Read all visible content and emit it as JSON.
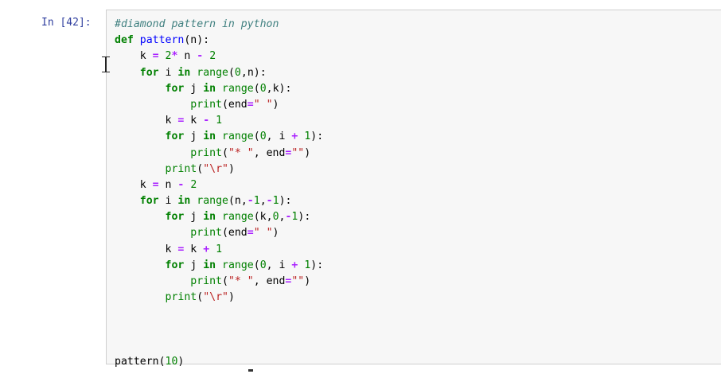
{
  "cell": {
    "prompt": "In [42]:",
    "code_lines": [
      [
        {
          "t": "#diamond pattern in python",
          "c": "cm-comment"
        }
      ],
      [
        {
          "t": "def",
          "c": "cm-keyword"
        },
        {
          "t": " ",
          "c": ""
        },
        {
          "t": "pattern",
          "c": "cm-def"
        },
        {
          "t": "(n):",
          "c": ""
        }
      ],
      [
        {
          "t": "    k ",
          "c": ""
        },
        {
          "t": "=",
          "c": "cm-operator"
        },
        {
          "t": " ",
          "c": ""
        },
        {
          "t": "2",
          "c": "cm-number"
        },
        {
          "t": "*",
          "c": "cm-operator"
        },
        {
          "t": " n ",
          "c": ""
        },
        {
          "t": "-",
          "c": "cm-operator"
        },
        {
          "t": " ",
          "c": ""
        },
        {
          "t": "2",
          "c": "cm-number"
        }
      ],
      [
        {
          "t": "    ",
          "c": ""
        },
        {
          "t": "for",
          "c": "cm-keyword"
        },
        {
          "t": " i ",
          "c": ""
        },
        {
          "t": "in",
          "c": "cm-keyword"
        },
        {
          "t": " ",
          "c": ""
        },
        {
          "t": "range",
          "c": "cm-builtin"
        },
        {
          "t": "(",
          "c": ""
        },
        {
          "t": "0",
          "c": "cm-number"
        },
        {
          "t": ",n):",
          "c": ""
        }
      ],
      [
        {
          "t": "        ",
          "c": ""
        },
        {
          "t": "for",
          "c": "cm-keyword"
        },
        {
          "t": " j ",
          "c": ""
        },
        {
          "t": "in",
          "c": "cm-keyword"
        },
        {
          "t": " ",
          "c": ""
        },
        {
          "t": "range",
          "c": "cm-builtin"
        },
        {
          "t": "(",
          "c": ""
        },
        {
          "t": "0",
          "c": "cm-number"
        },
        {
          "t": ",k):",
          "c": ""
        }
      ],
      [
        {
          "t": "            ",
          "c": ""
        },
        {
          "t": "print",
          "c": "cm-builtin"
        },
        {
          "t": "(end",
          "c": ""
        },
        {
          "t": "=",
          "c": "cm-operator"
        },
        {
          "t": "\" \"",
          "c": "cm-string"
        },
        {
          "t": ")",
          "c": ""
        }
      ],
      [
        {
          "t": "        k ",
          "c": ""
        },
        {
          "t": "=",
          "c": "cm-operator"
        },
        {
          "t": " k ",
          "c": ""
        },
        {
          "t": "-",
          "c": "cm-operator"
        },
        {
          "t": " ",
          "c": ""
        },
        {
          "t": "1",
          "c": "cm-number"
        }
      ],
      [
        {
          "t": "        ",
          "c": ""
        },
        {
          "t": "for",
          "c": "cm-keyword"
        },
        {
          "t": " j ",
          "c": ""
        },
        {
          "t": "in",
          "c": "cm-keyword"
        },
        {
          "t": " ",
          "c": ""
        },
        {
          "t": "range",
          "c": "cm-builtin"
        },
        {
          "t": "(",
          "c": ""
        },
        {
          "t": "0",
          "c": "cm-number"
        },
        {
          "t": ", i ",
          "c": ""
        },
        {
          "t": "+",
          "c": "cm-operator"
        },
        {
          "t": " ",
          "c": ""
        },
        {
          "t": "1",
          "c": "cm-number"
        },
        {
          "t": "):",
          "c": ""
        }
      ],
      [
        {
          "t": "            ",
          "c": ""
        },
        {
          "t": "print",
          "c": "cm-builtin"
        },
        {
          "t": "(",
          "c": ""
        },
        {
          "t": "\"* \"",
          "c": "cm-string"
        },
        {
          "t": ", end",
          "c": ""
        },
        {
          "t": "=",
          "c": "cm-operator"
        },
        {
          "t": "\"\"",
          "c": "cm-string"
        },
        {
          "t": ")",
          "c": ""
        }
      ],
      [
        {
          "t": "        ",
          "c": ""
        },
        {
          "t": "print",
          "c": "cm-builtin"
        },
        {
          "t": "(",
          "c": ""
        },
        {
          "t": "\"\\r\"",
          "c": "cm-string"
        },
        {
          "t": ")",
          "c": ""
        }
      ],
      [
        {
          "t": "    k ",
          "c": ""
        },
        {
          "t": "=",
          "c": "cm-operator"
        },
        {
          "t": " n ",
          "c": ""
        },
        {
          "t": "-",
          "c": "cm-operator"
        },
        {
          "t": " ",
          "c": ""
        },
        {
          "t": "2",
          "c": "cm-number"
        }
      ],
      [
        {
          "t": "    ",
          "c": ""
        },
        {
          "t": "for",
          "c": "cm-keyword"
        },
        {
          "t": " i ",
          "c": ""
        },
        {
          "t": "in",
          "c": "cm-keyword"
        },
        {
          "t": " ",
          "c": ""
        },
        {
          "t": "range",
          "c": "cm-builtin"
        },
        {
          "t": "(n,",
          "c": ""
        },
        {
          "t": "-",
          "c": "cm-operator"
        },
        {
          "t": "1",
          "c": "cm-number"
        },
        {
          "t": ",",
          "c": ""
        },
        {
          "t": "-",
          "c": "cm-operator"
        },
        {
          "t": "1",
          "c": "cm-number"
        },
        {
          "t": "):",
          "c": ""
        }
      ],
      [
        {
          "t": "        ",
          "c": ""
        },
        {
          "t": "for",
          "c": "cm-keyword"
        },
        {
          "t": " j ",
          "c": ""
        },
        {
          "t": "in",
          "c": "cm-keyword"
        },
        {
          "t": " ",
          "c": ""
        },
        {
          "t": "range",
          "c": "cm-builtin"
        },
        {
          "t": "(k,",
          "c": ""
        },
        {
          "t": "0",
          "c": "cm-number"
        },
        {
          "t": ",",
          "c": ""
        },
        {
          "t": "-",
          "c": "cm-operator"
        },
        {
          "t": "1",
          "c": "cm-number"
        },
        {
          "t": "):",
          "c": ""
        }
      ],
      [
        {
          "t": "            ",
          "c": ""
        },
        {
          "t": "print",
          "c": "cm-builtin"
        },
        {
          "t": "(end",
          "c": ""
        },
        {
          "t": "=",
          "c": "cm-operator"
        },
        {
          "t": "\" \"",
          "c": "cm-string"
        },
        {
          "t": ")",
          "c": ""
        }
      ],
      [
        {
          "t": "        k ",
          "c": ""
        },
        {
          "t": "=",
          "c": "cm-operator"
        },
        {
          "t": " k ",
          "c": ""
        },
        {
          "t": "+",
          "c": "cm-operator"
        },
        {
          "t": " ",
          "c": ""
        },
        {
          "t": "1",
          "c": "cm-number"
        }
      ],
      [
        {
          "t": "        ",
          "c": ""
        },
        {
          "t": "for",
          "c": "cm-keyword"
        },
        {
          "t": " j ",
          "c": ""
        },
        {
          "t": "in",
          "c": "cm-keyword"
        },
        {
          "t": " ",
          "c": ""
        },
        {
          "t": "range",
          "c": "cm-builtin"
        },
        {
          "t": "(",
          "c": ""
        },
        {
          "t": "0",
          "c": "cm-number"
        },
        {
          "t": ", i ",
          "c": ""
        },
        {
          "t": "+",
          "c": "cm-operator"
        },
        {
          "t": " ",
          "c": ""
        },
        {
          "t": "1",
          "c": "cm-number"
        },
        {
          "t": "):",
          "c": ""
        }
      ],
      [
        {
          "t": "            ",
          "c": ""
        },
        {
          "t": "print",
          "c": "cm-builtin"
        },
        {
          "t": "(",
          "c": ""
        },
        {
          "t": "\"* \"",
          "c": "cm-string"
        },
        {
          "t": ", end",
          "c": ""
        },
        {
          "t": "=",
          "c": "cm-operator"
        },
        {
          "t": "\"\"",
          "c": "cm-string"
        },
        {
          "t": ")",
          "c": ""
        }
      ],
      [
        {
          "t": "        ",
          "c": ""
        },
        {
          "t": "print",
          "c": "cm-builtin"
        },
        {
          "t": "(",
          "c": ""
        },
        {
          "t": "\"\\r\"",
          "c": "cm-string"
        },
        {
          "t": ")",
          "c": ""
        }
      ],
      [
        {
          "t": "",
          "c": ""
        }
      ],
      [
        {
          "t": "",
          "c": ""
        }
      ],
      [
        {
          "t": "",
          "c": ""
        }
      ],
      [
        {
          "t": "pattern(",
          "c": ""
        },
        {
          "t": "10",
          "c": "cm-number"
        },
        {
          "t": ")",
          "c": ""
        }
      ]
    ]
  },
  "colors": {
    "prompt": "#303f9f",
    "cell_background": "#f7f7f7",
    "cell_border": "#cfcfcf",
    "keyword": "#008000",
    "comment": "#408080",
    "string": "#ba2121",
    "operator": "#aa22ff",
    "def_name": "#0000ff"
  },
  "icons": {
    "text_cursor": "ibeam-cursor-icon"
  }
}
